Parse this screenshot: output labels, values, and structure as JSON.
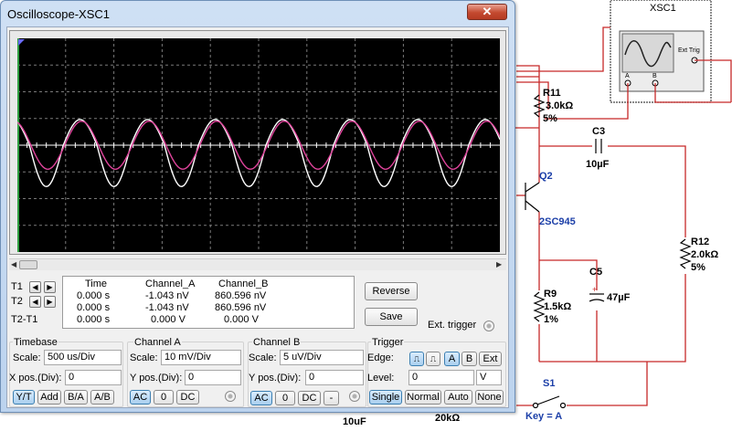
{
  "window": {
    "title": "Oscilloscope-XSC1",
    "close_label": "✕"
  },
  "colors": {
    "channel_a": "#ffffff",
    "channel_b": "#e0449c",
    "screen_bg": "#000000",
    "grid": "#7a7a7a",
    "wire": "#c62828"
  },
  "chart_data": {
    "type": "line",
    "title": "",
    "xlabel": "",
    "ylabel": "",
    "grid": true,
    "divisions": {
      "x": 10,
      "y": 8
    },
    "timebase_us_per_div": 500,
    "series": [
      {
        "name": "Channel_A",
        "color": "#ffffff",
        "shape": "clipped-sine",
        "period_div": 1.4,
        "amplitude_div": 1.55,
        "phase_div": 0.95
      },
      {
        "name": "Channel_B",
        "color": "#e0449c",
        "shape": "sine",
        "period_div": 1.4,
        "amplitude_div": 0.9,
        "phase_div": 0.98
      }
    ]
  },
  "cursors": {
    "t1": "T1",
    "t2": "T2",
    "t2_t1": "T2-T1",
    "headers": [
      "Time",
      "Channel_A",
      "Channel_B"
    ],
    "rows": [
      [
        "0.000 s",
        "-1.043 nV",
        "860.596 nV"
      ],
      [
        "0.000 s",
        "-1.043 nV",
        "860.596 nV"
      ],
      [
        "0.000 s",
        "0.000 V",
        "0.000 V"
      ]
    ]
  },
  "buttons": {
    "reverse": "Reverse",
    "save": "Save",
    "ext_trigger": "Ext. trigger"
  },
  "timebase": {
    "title": "Timebase",
    "scale_label": "Scale:",
    "scale": "500 us/Div",
    "xpos_label": "X pos.(Div):",
    "xpos": "0",
    "modes": [
      "Y/T",
      "Add",
      "B/A",
      "A/B"
    ],
    "selected_mode": "Y/T"
  },
  "channel_a": {
    "title": "Channel A",
    "scale_label": "Scale:",
    "scale": "10 mV/Div",
    "ypos_label": "Y pos.(Div):",
    "ypos": "0",
    "coupling": [
      "AC",
      "0",
      "DC"
    ],
    "selected": "AC"
  },
  "channel_b": {
    "title": "Channel B",
    "scale_label": "Scale:",
    "scale": "5 uV/Div",
    "ypos_label": "Y pos.(Div):",
    "ypos": "0",
    "coupling": [
      "AC",
      "0",
      "DC",
      "-"
    ],
    "selected": "AC"
  },
  "trigger": {
    "title": "Trigger",
    "edge_label": "Edge:",
    "edge_rise": "⎍",
    "edge_fall": "⎍",
    "sources": [
      "A",
      "B",
      "Ext"
    ],
    "selected_source": "A",
    "level_label": "Level:",
    "level": "0",
    "level_unit": "V",
    "modes": [
      "Single",
      "Normal",
      "Auto",
      "None"
    ],
    "selected_mode": "Single"
  },
  "schematic": {
    "instrument": "XSC1",
    "ext_trig": "Ext Trig",
    "port_a": "A",
    "port_b": "B",
    "r11_name": "R11",
    "r11_value": "3.0kΩ",
    "r11_tol": "5%",
    "c3_name": "C3",
    "c3_value": "10µF",
    "q2_name": "Q2",
    "q2_part": "2SC945",
    "r12_name": "R12",
    "r12_value": "2.0kΩ",
    "r12_tol": "5%",
    "r9_name": "R9",
    "r9_value": "1.5kΩ",
    "r9_tol": "1%",
    "c5_name": "C5",
    "c5_value": "47µF",
    "s1_name": "S1",
    "s1_key": "Key = A",
    "bottom_left": "10uF",
    "bottom_right": "20kΩ"
  }
}
